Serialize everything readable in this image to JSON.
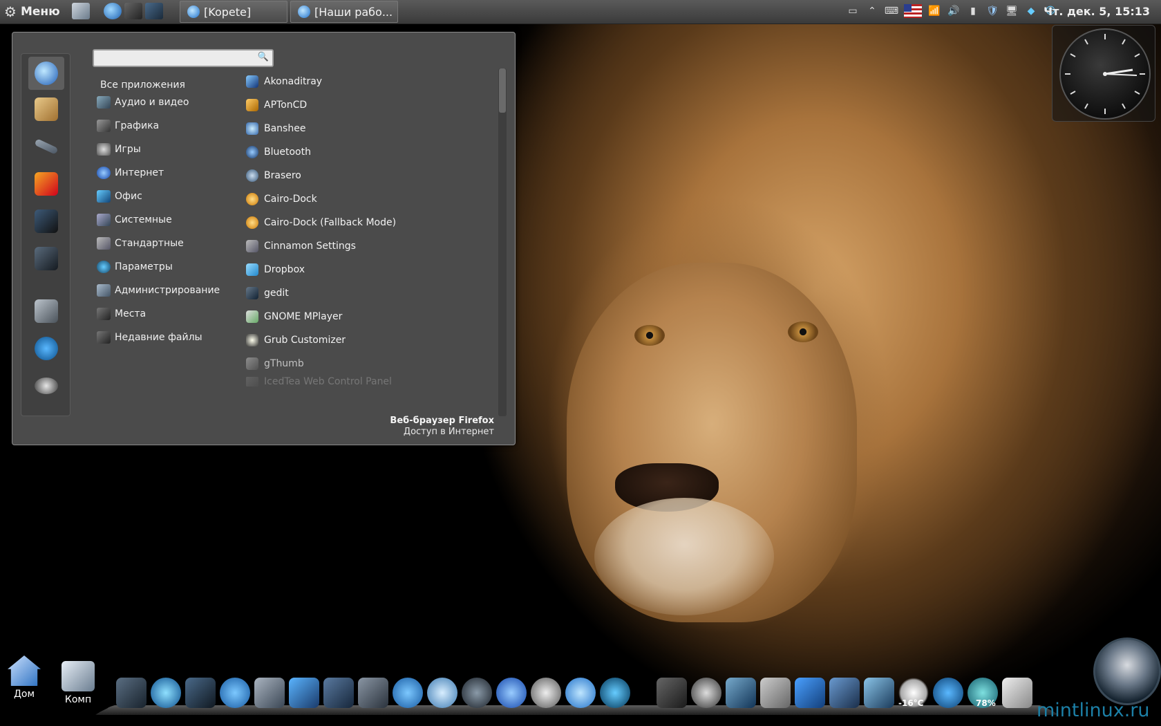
{
  "top_panel": {
    "menu_label": "Меню",
    "tasks": [
      {
        "label": "[Kopete]"
      },
      {
        "label": "[Наши рабо..."
      }
    ],
    "clock": "Чт. дек.  5, 15:13"
  },
  "menu": {
    "search": {
      "value": "",
      "placeholder": ""
    },
    "all_apps_label": "Все приложения",
    "categories": [
      {
        "label": "Аудио и видео"
      },
      {
        "label": "Графика"
      },
      {
        "label": "Игры"
      },
      {
        "label": "Интернет"
      },
      {
        "label": "Офис"
      },
      {
        "label": "Системные"
      },
      {
        "label": "Стандартные"
      },
      {
        "label": "Параметры"
      },
      {
        "label": "Администрирование"
      },
      {
        "label": "Места"
      },
      {
        "label": "Недавние файлы"
      }
    ],
    "apps": [
      {
        "label": "Akonaditray"
      },
      {
        "label": "APTonCD"
      },
      {
        "label": "Banshee"
      },
      {
        "label": "Bluetooth"
      },
      {
        "label": "Brasero"
      },
      {
        "label": "Cairo-Dock"
      },
      {
        "label": "Cairo-Dock (Fallback Mode)"
      },
      {
        "label": "Cinnamon Settings"
      },
      {
        "label": "Dropbox"
      },
      {
        "label": "gedit"
      },
      {
        "label": "GNOME MPlayer"
      },
      {
        "label": "Grub Customizer"
      },
      {
        "label": "gThumb"
      },
      {
        "label": "IcedTea Web Control Panel"
      }
    ],
    "description": {
      "title": "Веб-браузер Firefox",
      "subtitle": "Доступ в Интернет"
    }
  },
  "desktop": {
    "icons": [
      {
        "label": "Дом"
      },
      {
        "label": "Комп"
      }
    ]
  },
  "dock": {
    "weather_label": "-16°C",
    "battery_label": "78%"
  },
  "watermark": "mintlinux.ru"
}
